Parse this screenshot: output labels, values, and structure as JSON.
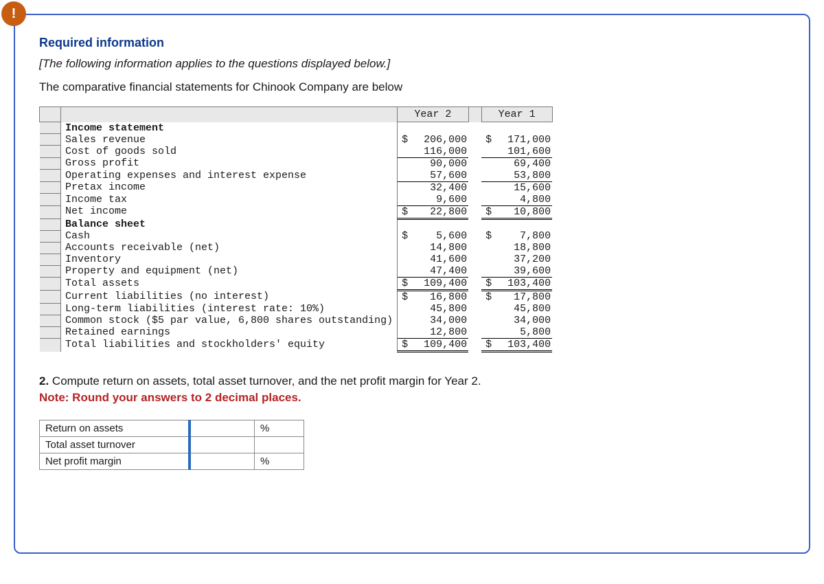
{
  "heading": "Required information",
  "italic_note": "[The following information applies to the questions displayed below.]",
  "intro": "The comparative financial statements for Chinook Company are below",
  "table": {
    "col1": "Year 2",
    "col2": "Year 1",
    "section1": "Income statement",
    "rows1": [
      {
        "label": "Sales revenue",
        "y2_pre": "$",
        "y2": "206,000",
        "y1_pre": "$",
        "y1": "171,000",
        "cls": ""
      },
      {
        "label": "Cost of goods sold",
        "y2_pre": "",
        "y2": "116,000",
        "y1_pre": "",
        "y1": "101,600",
        "cls": "u1"
      },
      {
        "label": "Gross profit",
        "y2_pre": "",
        "y2": "90,000",
        "y1_pre": "",
        "y1": "69,400",
        "cls": ""
      },
      {
        "label": "Operating expenses and interest expense",
        "y2_pre": "",
        "y2": "57,600",
        "y1_pre": "",
        "y1": "53,800",
        "cls": "u1"
      },
      {
        "label": "Pretax income",
        "y2_pre": "",
        "y2": "32,400",
        "y1_pre": "",
        "y1": "15,600",
        "cls": ""
      },
      {
        "label": "Income tax",
        "y2_pre": "",
        "y2": "9,600",
        "y1_pre": "",
        "y1": "4,800",
        "cls": "u1"
      },
      {
        "label": "Net income",
        "y2_pre": "$",
        "y2": "22,800",
        "y1_pre": "$",
        "y1": "10,800",
        "cls": "ud ut"
      }
    ],
    "section2": "Balance sheet",
    "rows2": [
      {
        "label": "Cash",
        "y2_pre": "$",
        "y2": "5,600",
        "y1_pre": "$",
        "y1": "7,800",
        "cls": ""
      },
      {
        "label": "Accounts receivable (net)",
        "y2_pre": "",
        "y2": "14,800",
        "y1_pre": "",
        "y1": "18,800",
        "cls": ""
      },
      {
        "label": "Inventory",
        "y2_pre": "",
        "y2": "41,600",
        "y1_pre": "",
        "y1": "37,200",
        "cls": ""
      },
      {
        "label": "Property and equipment (net)",
        "y2_pre": "",
        "y2": "47,400",
        "y1_pre": "",
        "y1": "39,600",
        "cls": "u1"
      },
      {
        "label": "Total assets",
        "y2_pre": "$",
        "y2": "109,400",
        "y1_pre": "$",
        "y1": "103,400",
        "cls": "ud ut"
      },
      {
        "label": "Current liabilities (no interest)",
        "y2_pre": "$",
        "y2": "16,800",
        "y1_pre": "$",
        "y1": "17,800",
        "cls": ""
      },
      {
        "label": "Long-term liabilities (interest rate: 10%)",
        "y2_pre": "",
        "y2": "45,800",
        "y1_pre": "",
        "y1": "45,800",
        "cls": ""
      },
      {
        "label": "Common stock ($5 par value, 6,800 shares outstanding)",
        "y2_pre": "",
        "y2": "34,000",
        "y1_pre": "",
        "y1": "34,000",
        "cls": ""
      },
      {
        "label": "Retained earnings",
        "y2_pre": "",
        "y2": "12,800",
        "y1_pre": "",
        "y1": "5,800",
        "cls": "u1"
      },
      {
        "label": "Total liabilities and stockholders' equity",
        "y2_pre": "$",
        "y2": "109,400",
        "y1_pre": "$",
        "y1": "103,400",
        "cls": "ud ut"
      }
    ]
  },
  "question": {
    "num": "2.",
    "text": " Compute return on assets, total asset turnover, and the net profit margin for Year 2.",
    "note": "Note: Round your answers to 2 decimal places."
  },
  "answers": {
    "rows": [
      {
        "label": "Return on assets",
        "unit": "%"
      },
      {
        "label": "Total asset turnover",
        "unit": ""
      },
      {
        "label": "Net profit margin",
        "unit": "%"
      }
    ]
  },
  "badge": "!"
}
